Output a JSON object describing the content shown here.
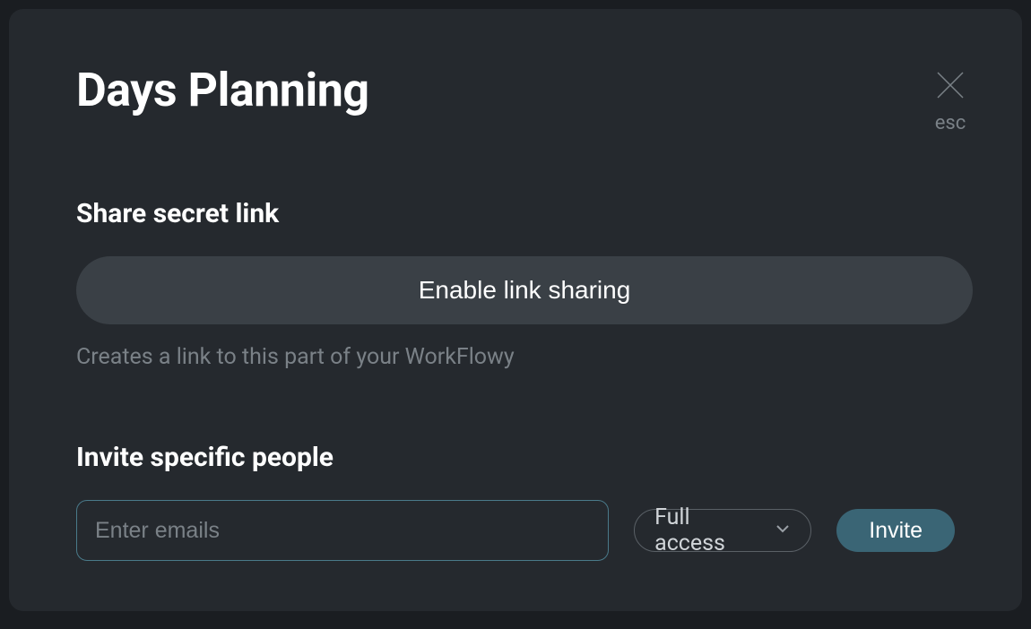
{
  "title": "Days Planning",
  "close": {
    "label": "esc"
  },
  "share_section": {
    "heading": "Share secret link",
    "button_label": "Enable link sharing",
    "hint": "Creates a link to this part of your WorkFlowy"
  },
  "invite_section": {
    "heading": "Invite specific people",
    "email_placeholder": "Enter emails",
    "access_label": "Full access",
    "invite_button_label": "Invite"
  }
}
